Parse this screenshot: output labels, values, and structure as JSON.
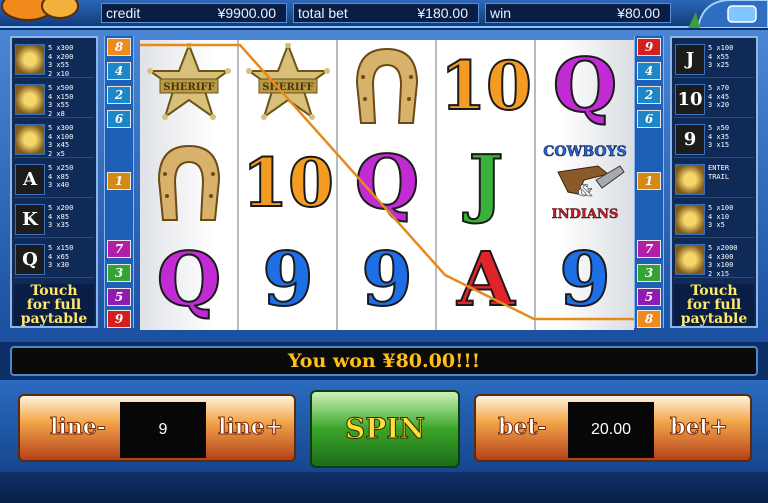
{
  "topbar": {
    "credit_label": "credit",
    "credit_value": "¥9900.00",
    "totalbet_label": "total bet",
    "totalbet_value": "¥180.00",
    "win_label": "win",
    "win_value": "¥80.00"
  },
  "left_paytable": {
    "rows": [
      {
        "icon": "cowboys-indians-logo-icon",
        "vals": [
          "5 x300",
          "4 x200",
          "3 x55",
          "2 x10"
        ]
      },
      {
        "icon": "cactus-icon",
        "vals": [
          "5 x500",
          "4 x150",
          "3 x55",
          "2 x8"
        ]
      },
      {
        "icon": "horseshoe-icon",
        "vals": [
          "5 x300",
          "4 x100",
          "3 x45",
          "2 x5"
        ]
      },
      {
        "icon": "letter-a-icon",
        "symbol": "A",
        "vals": [
          "5 x250",
          "4 x85",
          "3 x40"
        ]
      },
      {
        "icon": "letter-k-icon",
        "symbol": "K",
        "vals": [
          "5 x200",
          "4 x85",
          "3 x35"
        ]
      },
      {
        "icon": "letter-q-icon",
        "symbol": "Q",
        "vals": [
          "5 x150",
          "4 x65",
          "3 x30"
        ]
      }
    ],
    "touch": [
      "Touch",
      "for full",
      "paytable"
    ]
  },
  "right_paytable": {
    "rows": [
      {
        "icon": "letter-j-icon",
        "symbol": "J",
        "vals": [
          "5 x100",
          "4 x55",
          "3 x25"
        ]
      },
      {
        "icon": "number-10-icon",
        "symbol": "10",
        "vals": [
          "5 x70",
          "4 x45",
          "3 x20"
        ]
      },
      {
        "icon": "number-9-icon",
        "symbol": "9",
        "vals": [
          "5 x50",
          "4 x35",
          "3 x15"
        ]
      },
      {
        "icon": "sheriff-badge-icon",
        "vals": [
          "ENTER",
          "TRAIL"
        ]
      },
      {
        "icon": "cowboy-character-icon",
        "vals": [
          "5 x100",
          "4 x10",
          "3 x5"
        ]
      },
      {
        "icon": "indian-character-icon",
        "vals": [
          "5 x2000",
          "4 x300",
          "3 x100",
          "2 x15"
        ]
      }
    ],
    "touch": [
      "Touch",
      "for full",
      "paytable"
    ]
  },
  "left_lines": [
    {
      "n": "8",
      "color": "#f08a1c"
    },
    {
      "n": "4",
      "color": "#1c86c9"
    },
    {
      "n": "2",
      "color": "#1c86c9"
    },
    {
      "n": "6",
      "color": "#1c86c9"
    },
    {
      "n": "1",
      "color": "#d68a13"
    },
    {
      "n": "7",
      "color": "#b21ea8"
    },
    {
      "n": "3",
      "color": "#35a233"
    },
    {
      "n": "5",
      "color": "#8f1ab4"
    },
    {
      "n": "9",
      "color": "#d81d1d"
    }
  ],
  "right_lines": [
    {
      "n": "9",
      "color": "#d81d1d"
    },
    {
      "n": "4",
      "color": "#1c86c9"
    },
    {
      "n": "2",
      "color": "#1c86c9"
    },
    {
      "n": "6",
      "color": "#1c86c9"
    },
    {
      "n": "1",
      "color": "#d68a13"
    },
    {
      "n": "7",
      "color": "#b21ea8"
    },
    {
      "n": "3",
      "color": "#35a233"
    },
    {
      "n": "5",
      "color": "#8f1ab4"
    },
    {
      "n": "8",
      "color": "#f08a1c"
    }
  ],
  "reels": [
    [
      "sheriff-badge",
      "horseshoe",
      "Q"
    ],
    [
      "sheriff-badge",
      "10",
      "9"
    ],
    [
      "horseshoe",
      "Q",
      "9"
    ],
    [
      "10",
      "J",
      "A"
    ],
    [
      "Q",
      "cowboys-indians-logo",
      "9"
    ]
  ],
  "reel_text": {
    "sheriff": "SHERIFF",
    "logo_top": "COWBOYS",
    "logo_mid": "&",
    "logo_bot": "INDIANS"
  },
  "win_message": "You won ¥80.00!!!",
  "controls": {
    "line_minus": "line-",
    "line_value": "9",
    "line_plus": "line+",
    "spin": "SPIN",
    "bet_minus": "bet-",
    "bet_value": "20.00",
    "bet_plus": "bet+"
  },
  "colors": {
    "win_text": "#ffbf1a",
    "spin_label": "#ffe03a",
    "payline": "#e88a1a"
  }
}
